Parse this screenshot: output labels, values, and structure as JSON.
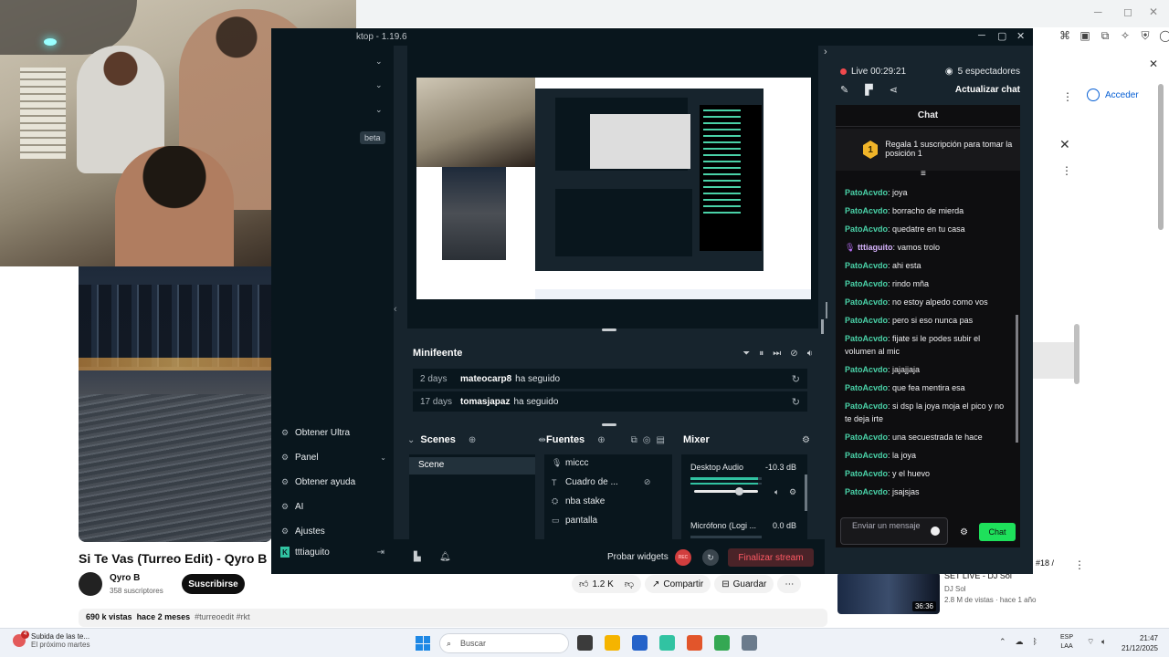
{
  "app": {
    "title": "ktop - 1.19.6",
    "beta_badge": "beta",
    "sidebar_menu": [
      {
        "label": "Obtener Ultra",
        "icon": "ultra-icon"
      },
      {
        "label": "Panel",
        "icon": "panel-icon"
      },
      {
        "label": "Obtener ayuda",
        "icon": "help-icon"
      },
      {
        "label": "AI",
        "icon": "ai-icon"
      },
      {
        "label": "Ajustes",
        "icon": "settings-icon"
      }
    ],
    "user": "tttiaguito"
  },
  "minifeed": {
    "title": "Minifeente",
    "items": [
      {
        "time": "2 days",
        "user": "mateocarp8",
        "action": "ha seguido"
      },
      {
        "time": "17 days",
        "user": "tomasjapaz",
        "action": "ha seguido"
      }
    ]
  },
  "scenes": {
    "title": "Scenes",
    "items": [
      "Scene"
    ]
  },
  "sources": {
    "title": "Fuentes",
    "items": [
      {
        "label": "miccc",
        "icon": "mic-icon"
      },
      {
        "label": "Cuadro de ...",
        "icon": "text-icon"
      },
      {
        "label": "nba stake",
        "icon": "user-icon"
      },
      {
        "label": "pantalla",
        "icon": "monitor-icon"
      }
    ]
  },
  "mixer": {
    "title": "Mixer",
    "channels": [
      {
        "name": "Desktop Audio",
        "db": "-10.3 dB",
        "level": 0.95,
        "volume": 0.72
      },
      {
        "name": "Micrófono (Logi ...",
        "db": "0.0 dB",
        "level": 0.0,
        "volume": 1.0
      }
    ]
  },
  "bottombar": {
    "test_widgets": "Probar widgets",
    "rec": "REC",
    "end_stream": "Finalizar stream"
  },
  "stream": {
    "live_time": "Live 00:29:21",
    "viewers": "5 espectadores",
    "refresh_chat": "Actualizar chat"
  },
  "chat": {
    "title": "Chat",
    "sub_banner": "Regala 1 suscripción para tomar la posición 1",
    "sub_banner_badge": "1",
    "messages": [
      {
        "user": "PatoAcvdo",
        "text": "joya"
      },
      {
        "user": "PatoAcvdo",
        "text": "borracho de mierda"
      },
      {
        "user": "PatoAcvdo",
        "text": "quedatre en tu casa"
      },
      {
        "user": "tttiaguito",
        "text": "vamos trolo"
      },
      {
        "user": "PatoAcvdo",
        "text": "ahi esta"
      },
      {
        "user": "PatoAcvdo",
        "text": "rindo mña"
      },
      {
        "user": "PatoAcvdo",
        "text": "no estoy alpedo como vos"
      },
      {
        "user": "PatoAcvdo",
        "text": "pero si eso nunca pas"
      },
      {
        "user": "PatoAcvdo",
        "text": "fijate si le podes subir el volumen al mic"
      },
      {
        "user": "PatoAcvdo",
        "text": "jajajjaja"
      },
      {
        "user": "PatoAcvdo",
        "text": "que fea mentira esa"
      },
      {
        "user": "PatoAcvdo",
        "text": "si dsp la joya moja el pico y no te deja irte"
      },
      {
        "user": "PatoAcvdo",
        "text": "una secuestrada te hace"
      },
      {
        "user": "PatoAcvdo",
        "text": "la joya"
      },
      {
        "user": "PatoAcvdo",
        "text": "y el huevo"
      },
      {
        "user": "PatoAcvdo",
        "text": "jsajsjas"
      }
    ],
    "input_placeholder": "Enviar un mensaje",
    "send_label": "Chat"
  },
  "youtube": {
    "video_title": "Si Te Vas (Turreo Edit) - Qyro B",
    "channel": "Qyro B",
    "subscribers": "358 suscriptores",
    "subscribe": "Suscribirse",
    "likes": "1.2 K",
    "share": "Compartir",
    "save": "Guardar",
    "views": "690 k vistas",
    "age": "hace 2 meses",
    "tags": "#turreoedit #rkt",
    "login": "Acceder",
    "rec_title": "SET LIVE - DJ Sol",
    "rec_channel": "DJ Sol",
    "rec_meta": "2.8 M de vistas · hace 1 año",
    "rec_duration": "36:36",
    "rec_number": "#18 /"
  },
  "taskbar": {
    "notif_badge": "4",
    "notif_title": "Subida de las te...",
    "notif_sub": "El próximo martes",
    "search": "Buscar",
    "lang1": "ESP",
    "lang2": "LAA",
    "time": "21:47",
    "date": "21/12/2025"
  },
  "colors": {
    "app_bg": "#17242d",
    "accent": "#31c3a2",
    "chat_user": "#4ad2a8",
    "end_stream": "#ff5a64",
    "chat_send": "#1ee05b"
  }
}
